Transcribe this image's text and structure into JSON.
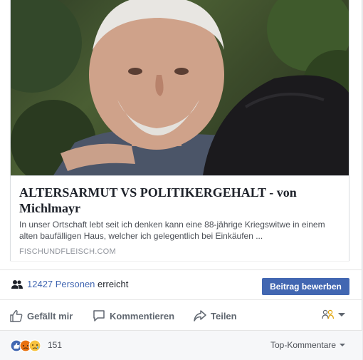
{
  "link_preview": {
    "title": "ALTERSARMUT VS POLITIKERGEHALT - von Michlmayr",
    "description": "In unser Ortschaft lebt seit ich denken kann eine 88-jährige Kriegswitwe in einem alten baufälligen Haus, welcher ich gelegentlich bei Einkäufen ...",
    "domain": "FISCHUNDFLEISCH.COM",
    "image_icon": "photo-two-people-selfie"
  },
  "reach": {
    "count": "12427 Personen",
    "label": "erreicht",
    "promote_label": "Beitrag bewerben",
    "icon": "people-icon"
  },
  "actions": {
    "like_label": "Gefällt mir",
    "comment_label": "Kommentieren",
    "share_label": "Teilen",
    "audience_icon": "friends-icon"
  },
  "reactions": {
    "count": "151",
    "icons": [
      "like-icon",
      "angry-icon",
      "sad-icon"
    ],
    "sort_label": "Top-Kommentare"
  },
  "colors": {
    "accent": "#4267b2",
    "muted_text": "#606770",
    "background": "#e9ebee"
  }
}
